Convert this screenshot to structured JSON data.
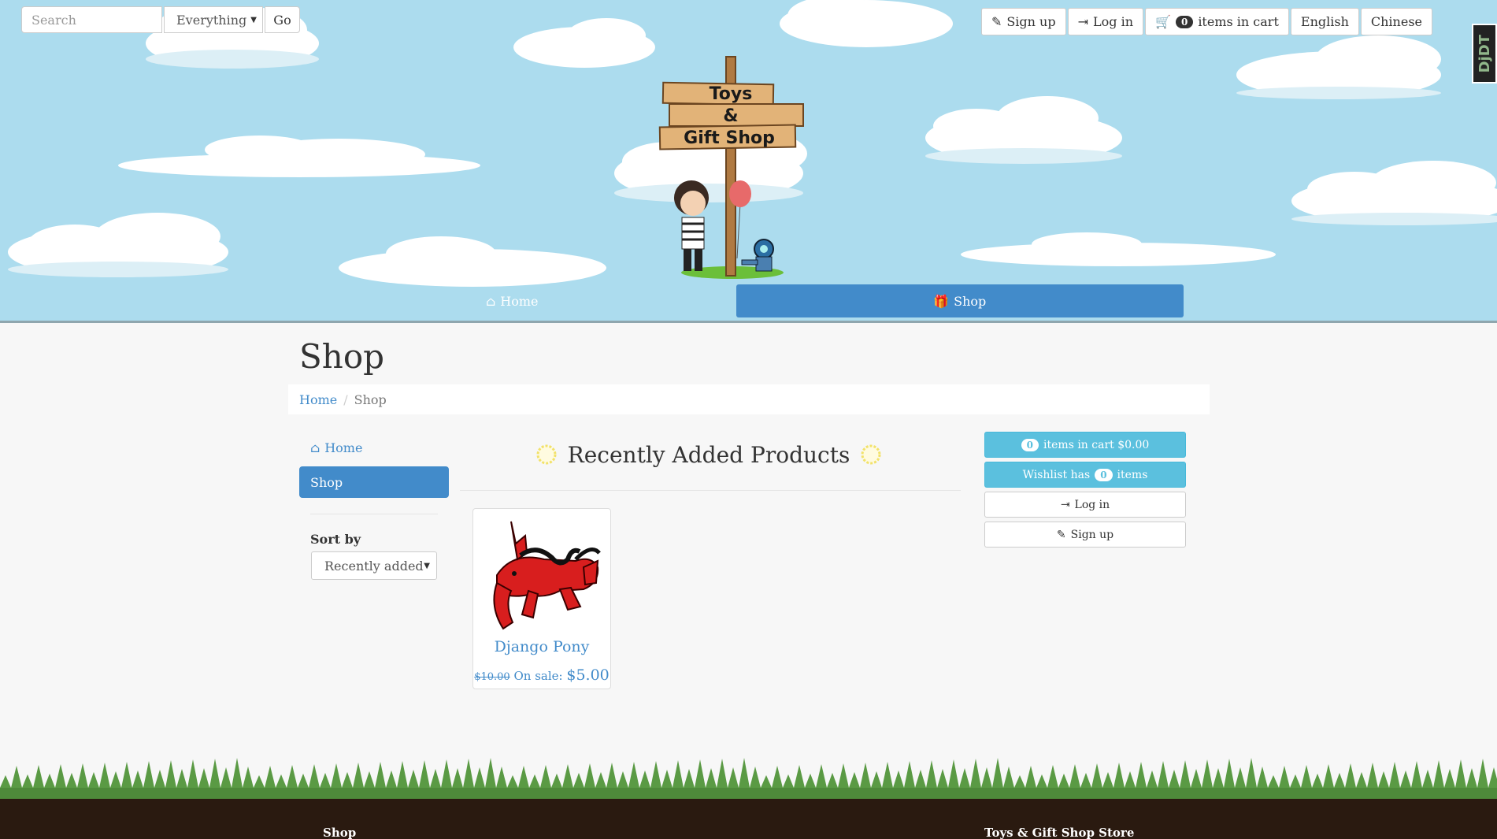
{
  "header": {
    "search": {
      "placeholder": "Search"
    },
    "search_scope": {
      "selected": "Everything"
    },
    "go_label": "Go",
    "signup_label": "Sign up",
    "login_label": "Log in",
    "cart_count": "0",
    "cart_label": "items in cart",
    "lang_english": "English",
    "lang_chinese": "Chinese",
    "djdt_label": "DjDT",
    "logo": {
      "line1": "Toys",
      "line2": "&",
      "line3": "Gift Shop"
    }
  },
  "nav": {
    "items": [
      {
        "label": "Home",
        "icon": "home-icon",
        "active": false
      },
      {
        "label": "Shop",
        "icon": "gift-icon",
        "active": true
      }
    ]
  },
  "page": {
    "title": "Shop",
    "breadcrumb": {
      "home": "Home",
      "separator": "/",
      "current": "Shop"
    }
  },
  "sidebar": {
    "items": [
      {
        "label": "Home",
        "icon": "home-icon"
      },
      {
        "label": "Shop"
      }
    ],
    "sort_label": "Sort by",
    "sort_selected": "Recently added"
  },
  "main": {
    "section_title": "Recently Added Products",
    "products": [
      {
        "name": "Django Pony",
        "old_price": "$10.00",
        "sale_label": "On sale:",
        "sale_price": "$5.00"
      }
    ]
  },
  "rightcol": {
    "cart_count": "0",
    "cart_text": "items in cart $0.00",
    "wishlist_prefix": "Wishlist has",
    "wishlist_count": "0",
    "wishlist_suffix": "items",
    "login_label": "Log in",
    "signup_label": "Sign up"
  },
  "footer": {
    "col1": "Shop",
    "col2": "Toys & Gift Shop Store"
  },
  "colors": {
    "sky": "#acdcee",
    "primary": "#428bca",
    "info": "#5bc0de",
    "grass": "#5a9a44",
    "footer": "#2a1a10"
  }
}
